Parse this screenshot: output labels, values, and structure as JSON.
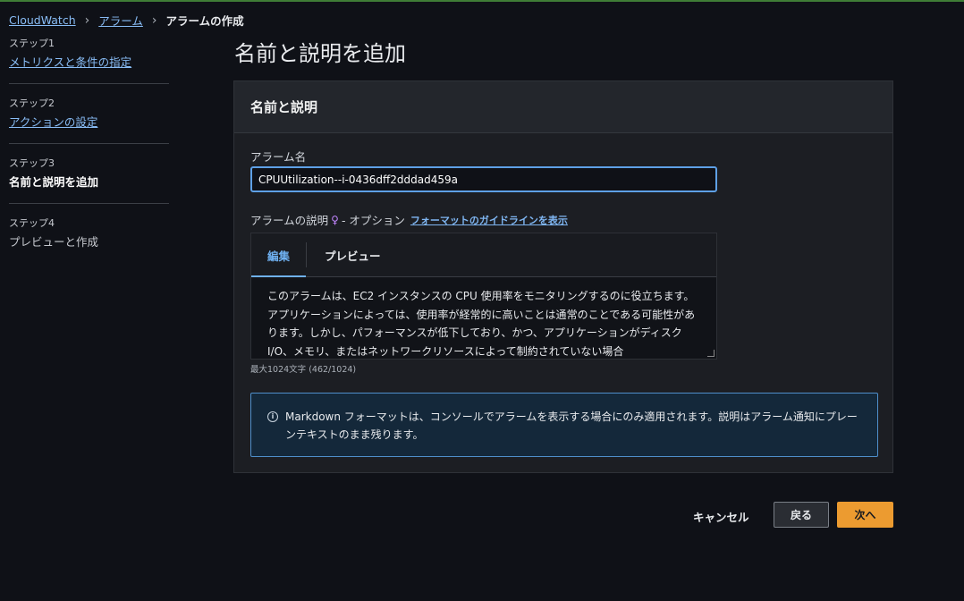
{
  "breadcrumb": {
    "items": [
      {
        "label": "CloudWatch"
      },
      {
        "label": "アラーム"
      }
    ],
    "current": "アラームの作成"
  },
  "steps": [
    {
      "num": "ステップ1",
      "label": "メトリクスと条件の指定",
      "link": true
    },
    {
      "num": "ステップ2",
      "label": "アクションの設定",
      "link": true
    },
    {
      "num": "ステップ3",
      "label": "名前と説明を追加",
      "active": true
    },
    {
      "num": "ステップ4",
      "label": "プレビューと作成"
    }
  ],
  "page_title": "名前と説明を追加",
  "panel": {
    "title": "名前と説明",
    "name_label": "アラーム名",
    "name_value": "CPUUtilization--i-0436dff2dddad459a",
    "desc_label": "アラームの説明",
    "desc_icon": "lightbulb-icon",
    "desc_optional": "- オプション",
    "desc_guide_link": "フォーマットのガイドラインを表示",
    "tabs": {
      "edit": "編集",
      "preview": "プレビュー"
    },
    "description_text": "このアラームは、EC2 インスタンスの CPU 使用率をモニタリングするのに役立ちます。アプリケーションによっては、使用率が経常的に高いことは通常のことである可能性があります。しかし、パフォーマンスが低下しており、かつ、アプリケーションがディスク I/O、メモリ、またはネットワークリソースによって制約されていない場合",
    "counter": "最大1024文字 (462/1024)",
    "info_text": "Markdown フォーマットは、コンソールでアラームを表示する場合にのみ適用されます。説明はアラーム通知にプレーンテキストのまま残ります。"
  },
  "footer": {
    "cancel": "キャンセル",
    "back": "戻る",
    "next": "次へ"
  },
  "colors": {
    "accent_link": "#89bdf6",
    "primary_button": "#ec9b30",
    "info_border": "#4f8fcb"
  }
}
